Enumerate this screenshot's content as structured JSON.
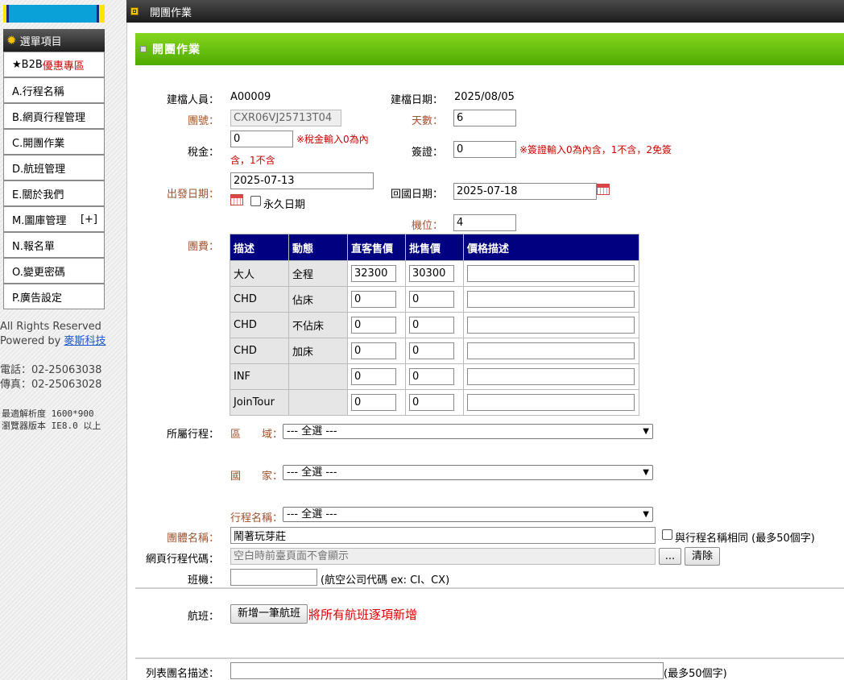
{
  "sidebar": {
    "menu_title": "選單項目",
    "items": [
      {
        "prefix": "★B2B",
        "highlight": "優惠專區"
      },
      {
        "label": "A.行程名稱"
      },
      {
        "label": "B.網頁行程管理"
      },
      {
        "label": "C.開團作業"
      },
      {
        "label": "D.航班管理"
      },
      {
        "label": "E.關於我們"
      },
      {
        "label": "M.圖庫管理",
        "extra": "[+]"
      },
      {
        "label": "N.報名單"
      },
      {
        "label": "O.變更密碼"
      },
      {
        "label": "P.廣告設定"
      }
    ],
    "rights": "All Rights Reserved",
    "powered_by": "Powered by",
    "powered_link": "麥斯科技",
    "phone": "電話：02-25063038",
    "fax": "傳真：02-25063028",
    "resolution": "最適解析度 1600*900",
    "browser": "瀏覽器版本 IE8.0 以上"
  },
  "topbar": {
    "title": "開團作業"
  },
  "section": {
    "title": "開團作業"
  },
  "form": {
    "creator_label": "建檔人員：",
    "creator_value": "A00009",
    "create_date_label": "建檔日期：",
    "create_date_value": "2025/08/05",
    "group_no_label": "團號：",
    "group_no_value": "CXR06VJ25713T04",
    "days_label": "天數：",
    "days_value": "6",
    "tax_label": "稅金：",
    "tax_value": "0",
    "tax_note_1": "※稅金輸入0為內",
    "tax_note_2": "含，1不含",
    "visa_label": "簽證：",
    "visa_value": "0",
    "visa_note": "※簽證輸入0為內含，1不含，2免簽",
    "depart_label": "出發日期：",
    "depart_value": "2025-07-13",
    "permanent_label": "永久日期",
    "return_label": "回國日期：",
    "return_value": "2025-07-18",
    "seats_label": "機位：",
    "seats_value": "4",
    "fee_label": "團費：",
    "price_headers": [
      "描述",
      "動態",
      "直客售價",
      "批售價",
      "價格描述"
    ],
    "price_rows": [
      {
        "desc": "大人",
        "dyn": "全程",
        "retail": "32300",
        "whole": "30300",
        "note": ""
      },
      {
        "desc": "CHD",
        "dyn": "佔床",
        "retail": "0",
        "whole": "0",
        "note": ""
      },
      {
        "desc": "CHD",
        "dyn": "不佔床",
        "retail": "0",
        "whole": "0",
        "note": ""
      },
      {
        "desc": "CHD",
        "dyn": "加床",
        "retail": "0",
        "whole": "0",
        "note": ""
      },
      {
        "desc": "INF",
        "dyn": "",
        "retail": "0",
        "whole": "0",
        "note": ""
      },
      {
        "desc": "JoinTour",
        "dyn": "",
        "retail": "0",
        "whole": "0",
        "note": ""
      }
    ],
    "itinerary_label": "所屬行程：",
    "region_label": "區　　域：",
    "region_value": "--- 全選 ---",
    "country_label": "國　　家：",
    "country_value": "--- 全選 ---",
    "trip_name_label": "行程名稱：",
    "trip_name_value": "--- 全選 ---",
    "group_name_label": "團體名稱：",
    "group_name_value": "鬧著玩芽莊",
    "same_name_label": "與行程名稱相同 (最多50個字)",
    "web_code_label": "網頁行程代碼：",
    "web_code_placeholder": "空白時前臺頁面不會顯示",
    "browse_btn": "...",
    "clear_btn": "清除",
    "airline_label": "班機：",
    "airline_value": "",
    "airline_note": "(航空公司代碼 ex: CI、CX)",
    "flight_label": "航班：",
    "add_flight_btn": "新增一筆航班",
    "add_flight_note": "將所有航班逐項新增",
    "list_desc_label": "列表團名描述：",
    "list_desc_value": "",
    "list_desc_note": "(最多50個字)"
  }
}
